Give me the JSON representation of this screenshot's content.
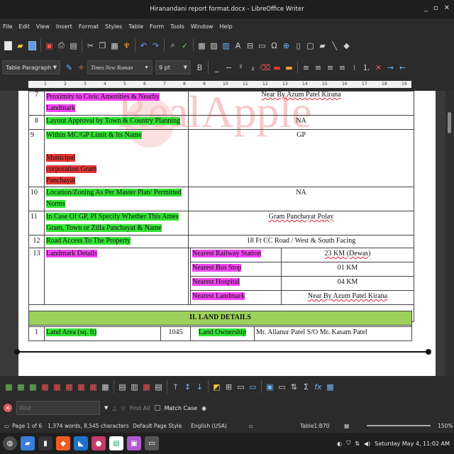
{
  "window": {
    "title": "Hiranandani report format.docx - LibreOffice Writer"
  },
  "menu": [
    "File",
    "Edit",
    "View",
    "Insert",
    "Format",
    "Styles",
    "Table",
    "Form",
    "Tools",
    "Window",
    "Help"
  ],
  "format": {
    "para_style": "Table Paragraph",
    "font_name": "Times New Roman",
    "font_size": "9 pt"
  },
  "ruler": {
    "ticks": [
      "1",
      "1",
      "2",
      "3",
      "4",
      "5",
      "6",
      "7",
      "8",
      "9",
      "10",
      "11",
      "12",
      "13",
      "14",
      "15",
      "16",
      "17",
      "18",
      "19"
    ]
  },
  "watermark": "RealApple",
  "table": {
    "row7": {
      "num": "7",
      "label": "Proximity to Civic Amenities & Nearby Landmark",
      "value": "Near By Azum Patel Kirana"
    },
    "row8": {
      "num": "8",
      "label": "Layout Approval by Town & Country Planning",
      "value": "NA"
    },
    "row9": {
      "num": "9",
      "label": "Within MC/GP Limit & Its Name",
      "label2": "Municipal corporation Gram Panchayat",
      "value": "GP"
    },
    "row10": {
      "num": "10",
      "label": "Location/Zoning As Per Master Plan/ Permitted Norms",
      "value": "NA"
    },
    "row11": {
      "num": "11",
      "label": "In Case Of GP, PI Specify Whether This Ames Gram, Town or Zilla Panchayat & Name",
      "value": "Gram Panchayat Polay"
    },
    "row12": {
      "num": "12",
      "label": "Road Access To The Property",
      "value": "18 Ft CC Road / West & South Facing"
    },
    "row13": {
      "num": "13",
      "label": "Landmark Details",
      "sub": [
        {
          "label": "Nearest Railway Station",
          "value": "23 KM (Dewas)"
        },
        {
          "label": "Nearest Bus Stop",
          "value": "01 KM"
        },
        {
          "label": "Nearest Hospital",
          "value": "04 KM"
        },
        {
          "label": "Nearest Landmark",
          "value": "Near By Azum Patel Kirana"
        }
      ]
    },
    "section2": "II. LAND DETAILS",
    "land": {
      "num": "1",
      "label": "Land Area (sq. ft)",
      "area": "1045",
      "own_label": "Land Ownership",
      "owner": "Mr. Allanur Patel S/O Mr. Kasam Patel"
    }
  },
  "find": {
    "placeholder": "Find",
    "find_all": "Find All",
    "match_case": "Match Case"
  },
  "status": {
    "page": "Page 1 of 6",
    "words": "1,374 words, 8,545 characters",
    "page_style": "Default Page Style",
    "language": "English (USA)",
    "table_cell": "Table1:B70",
    "zoom": "150%"
  },
  "taskbar": {
    "clock": "Saturday May 4, 11:02 AM"
  }
}
